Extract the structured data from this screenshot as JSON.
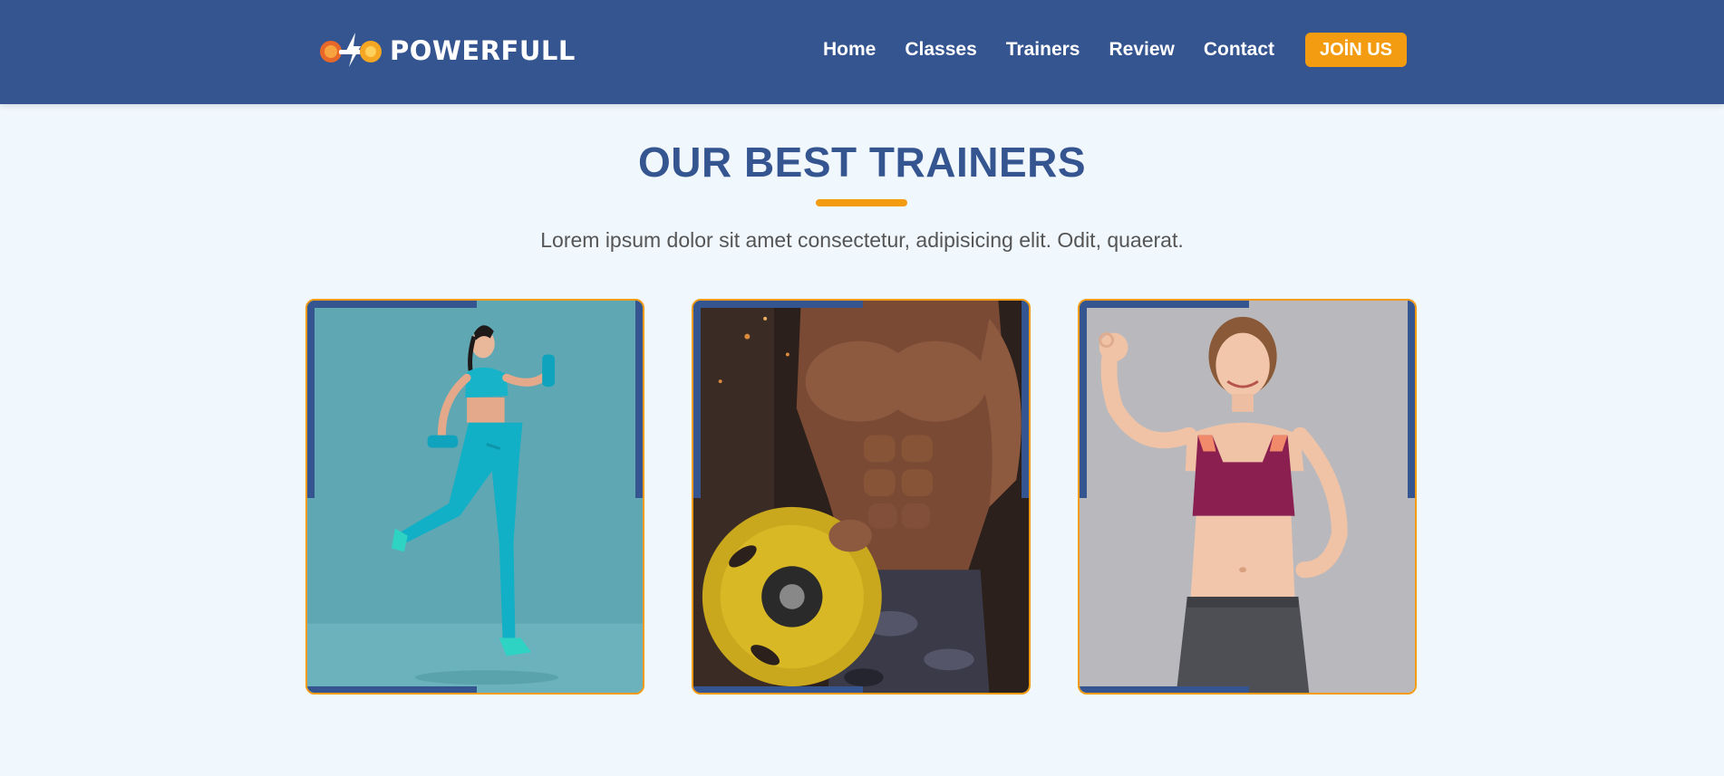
{
  "header": {
    "brand": "POWERFULL",
    "nav": [
      "Home",
      "Classes",
      "Trainers",
      "Review",
      "Contact"
    ],
    "cta": "JOİN US"
  },
  "colors": {
    "primary": "#355591",
    "accent": "#f39c12",
    "background": "#f0f7fd",
    "text_muted": "#555555"
  },
  "section": {
    "title": "OUR BEST TRAINERS",
    "subtitle": "Lorem ipsum dolor sit amet consectetur, adipisicing elit. Odit, quaerat."
  },
  "trainers": [
    {
      "photo": "female-trainer-with-dumbbells-running"
    },
    {
      "photo": "muscular-trainer-holding-weight-plate"
    },
    {
      "photo": "female-trainer-ok-gesture"
    }
  ]
}
